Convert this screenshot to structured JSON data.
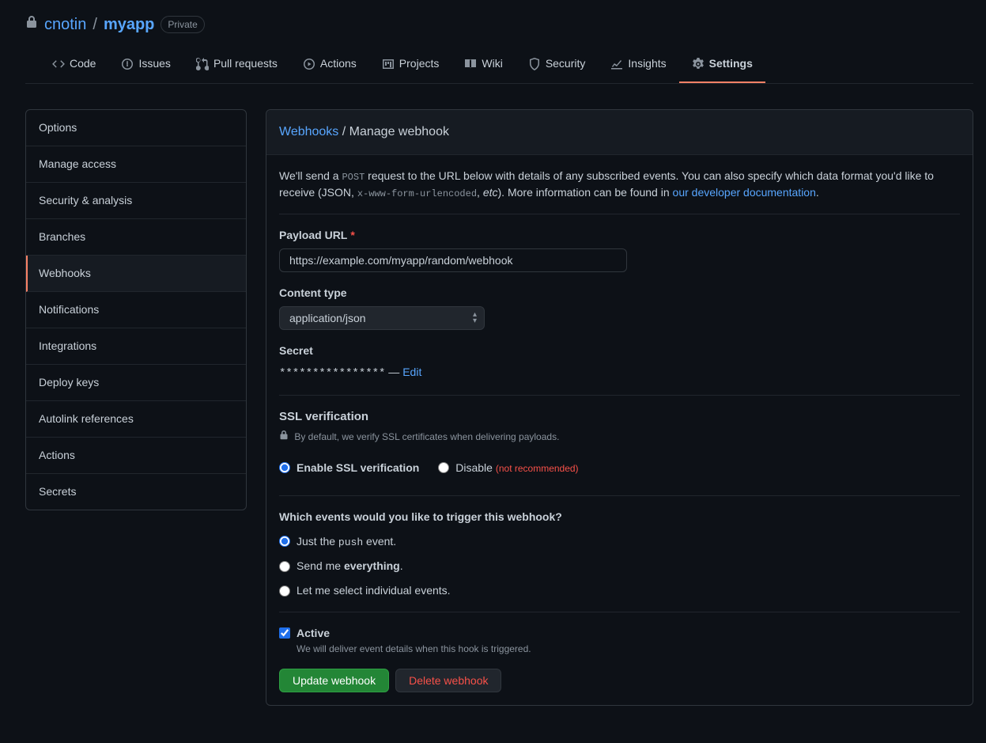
{
  "repo": {
    "owner": "cnotin",
    "name": "myapp",
    "visibility": "Private"
  },
  "tabs": {
    "code": "Code",
    "issues": "Issues",
    "pulls": "Pull requests",
    "actions": "Actions",
    "projects": "Projects",
    "wiki": "Wiki",
    "security": "Security",
    "insights": "Insights",
    "settings": "Settings"
  },
  "sidebar": {
    "items": [
      "Options",
      "Manage access",
      "Security & analysis",
      "Branches",
      "Webhooks",
      "Notifications",
      "Integrations",
      "Deploy keys",
      "Autolink references",
      "Actions",
      "Secrets"
    ]
  },
  "breadcrumb": {
    "root": "Webhooks",
    "sep": " / ",
    "current": "Manage webhook"
  },
  "desc": {
    "p1": "We'll send a ",
    "code1": "POST",
    "p2": " request to the URL below with details of any subscribed events. You can also specify which data format you'd like to receive (JSON, ",
    "code2": "x-www-form-urlencoded",
    "p3": ", ",
    "etc": "etc",
    "p4": "). More information can be found in ",
    "link": "our developer documentation",
    "p5": "."
  },
  "form": {
    "payload_label": "Payload URL",
    "payload_value": "https://example.com/myapp/random/webhook",
    "content_label": "Content type",
    "content_value": "application/json",
    "secret_label": "Secret",
    "secret_mask": "****************",
    "secret_dash": " — ",
    "secret_edit": "Edit",
    "ssl_title": "SSL verification",
    "ssl_hint": "By default, we verify SSL certificates when delivering payloads.",
    "ssl_enable": "Enable SSL verification",
    "ssl_disable": "Disable",
    "ssl_notrec": "(not recommended)",
    "events_label": "Which events would you like to trigger this webhook?",
    "event_push_pre": "Just the ",
    "event_push_code": "push",
    "event_push_post": " event.",
    "event_all_pre": "Send me ",
    "event_all_bold": "everything",
    "event_all_post": ".",
    "event_sel": "Let me select individual events.",
    "active_label": "Active",
    "active_hint": "We will deliver event details when this hook is triggered.",
    "update_btn": "Update webhook",
    "delete_btn": "Delete webhook"
  }
}
